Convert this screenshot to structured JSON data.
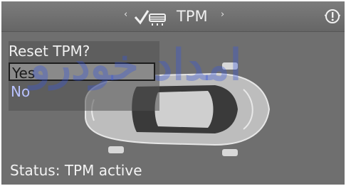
{
  "header": {
    "nav_left": "‹",
    "title": "TPM",
    "nav_right": "›",
    "icons": [
      "tire-check-icon",
      "warning-icon"
    ]
  },
  "menu": {
    "title": "Reset TPM?",
    "items": [
      {
        "label": "Yes",
        "selected": true
      },
      {
        "label": "No",
        "selected": false
      }
    ]
  },
  "status": {
    "text": "Status: TPM active"
  },
  "watermark": {
    "text": "امداد خودرو"
  },
  "colors": {
    "screen_bg": "#6f6f6f",
    "selected_item_bg": "#8a8a8a",
    "secondary_item_text": "#b9c2ff"
  }
}
